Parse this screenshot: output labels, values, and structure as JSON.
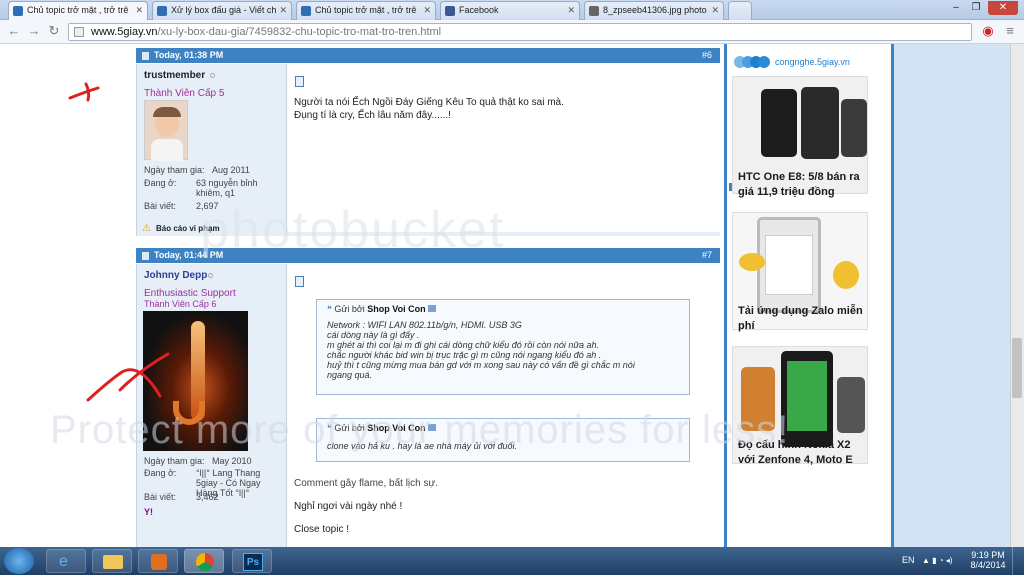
{
  "tabs": [
    {
      "label": "Chủ topic trở mặt , trở trê",
      "active": true
    },
    {
      "label": "Xử lý box đấu giá - Viết ch",
      "active": false
    },
    {
      "label": "Chủ topic trở mặt , trở trê",
      "active": false
    },
    {
      "label": "Facebook",
      "active": false
    },
    {
      "label": "8_zpseeb41306.jpg photo",
      "active": false
    }
  ],
  "url": {
    "domain": "www.5giay.vn",
    "path": "/xu-ly-box-dau-gia/7459832-chu-topic-tro-mat-tro-tren.html"
  },
  "post6": {
    "time": "Today, 01:38 PM",
    "num": "#6",
    "author": "trustmember",
    "rank": "Thành Viên Cấp 5",
    "joined_label": "Ngày tham gia:",
    "joined": "Aug 2011",
    "loc_label": "Đang ở:",
    "loc": "63 nguyễn bỉnh khiêm, q1",
    "posts_label": "Bài viết:",
    "posts": "2,697",
    "report": "Báo cáo vi phạm",
    "line1": "Người ta nói Ếch Ngồi Đáy Giếng Kêu To quả thật ko sai mà.",
    "line2": "Đụng tí là cry, Ếch lâu năm đây......!"
  },
  "post7": {
    "time": "Today, 01:44 PM",
    "num": "#7",
    "author": "Johnny Depp",
    "rank1": "Enthusiastic Support",
    "rank2": "Thành Viên Cấp 6",
    "joined_label": "Ngày tham gia:",
    "joined": "May 2010",
    "loc_label": "Đang ở:",
    "loc": "°l||° Lang Thang 5giay - Có Ngay Hàng Tốt °l||°",
    "posts_label": "Bài viết:",
    "posts": "3,462",
    "q1_prefix": "Gửi bởi",
    "q1_author": "Shop Voi Con",
    "q1_text": "Network : WIFI LAN 802.11b/g/n, HDMI. USB 3G\ncái dòng này là gì đấy .\nm ghét ai thì coi lại m đi ghi cái dòng chữ kiểu đó rồi còn nói nữa ah.\nchắc người khác bid win bị trục trặc gì m cũng nói ngang kiểu đó ah .\nhuỷ thì t cũng mừng mua bán gd với m xong sau này có vấn đề gì chắc m nói\nngang quá.",
    "q2_prefix": "Gửi bởi",
    "q2_author": "Shop Voi Con",
    "q2_text": "clone vào hả ku . hay là ae nhà máy ủi với đuối.",
    "c1": "Comment gây flame, bất lịch sự.",
    "c2": "Nghỉ ngơi vài ngày nhé !",
    "c3": "Close topic !"
  },
  "sidebar": {
    "brand": "congnghe.5giay.vn",
    "a1": "HTC One E8: 5/8 bán ra giá 11,9 triệu đồng",
    "a2": "Tải ứng dụng Zalo miễn phí",
    "a3": "Đọ cấu hình Nokia X2 với Zenfone 4, Moto E"
  },
  "watermark": {
    "w1": "photobucket",
    "w2": "Protect more of your memories for less!"
  },
  "taskbar": {
    "lang": "EN",
    "time": "9:19 PM",
    "date": "8/4/2014"
  },
  "colors": {
    "accent": "#3d82c2",
    "rank": "#a0309a"
  }
}
